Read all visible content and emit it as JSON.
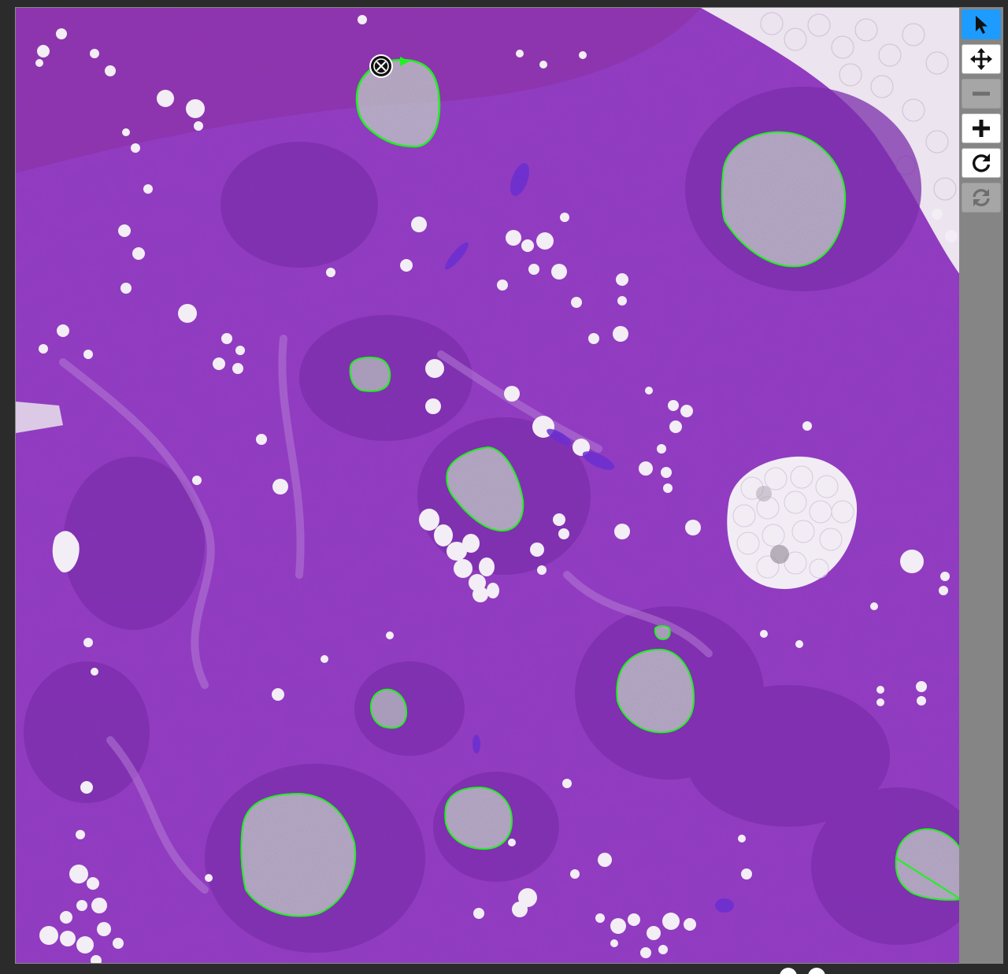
{
  "viewer": {
    "tissue_colors": {
      "background": "#8f3cc0",
      "dark_region": "#7d2fae",
      "follicle": "#7a2bab",
      "fat": "#f1ecf4",
      "annotation_stroke": "#1ef21e",
      "annotation_fill": "#b9c6be"
    },
    "annotation_count": 10,
    "selected_annotation_control": "close-circle-icon"
  },
  "toolbar": {
    "buttons": [
      {
        "name": "select-tool-button",
        "icon": "pointer-arrow-icon",
        "state": "active"
      },
      {
        "name": "pan-tool-button",
        "icon": "move-arrows-icon",
        "state": "enabled"
      },
      {
        "name": "zoom-out-button",
        "icon": "minus-icon",
        "state": "disabled"
      },
      {
        "name": "zoom-in-button",
        "icon": "plus-icon",
        "state": "enabled"
      },
      {
        "name": "rotate-button",
        "icon": "rotate-icon",
        "state": "enabled"
      },
      {
        "name": "refresh-button",
        "icon": "refresh-icon",
        "state": "disabled"
      }
    ],
    "colors": {
      "active": "#1e9bff",
      "panel": "#858585"
    }
  }
}
